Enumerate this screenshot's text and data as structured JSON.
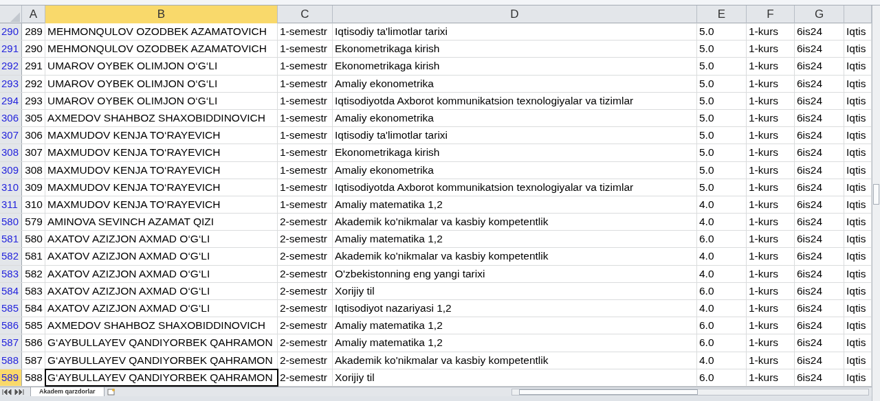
{
  "columns": [
    {
      "label": "A",
      "selected": false
    },
    {
      "label": "B",
      "selected": true
    },
    {
      "label": "C",
      "selected": false
    },
    {
      "label": "D",
      "selected": false
    },
    {
      "label": "E",
      "selected": false
    },
    {
      "label": "F",
      "selected": false
    },
    {
      "label": "G",
      "selected": false
    }
  ],
  "rows": [
    {
      "row": "290",
      "selected": false,
      "cells": [
        "289",
        "MEHMONQULOV OZODBEK AZAMATOVICH",
        "1-semestr",
        "Iqtisodiy ta'limotlar tarixi",
        "5.0",
        "1-kurs",
        "6is24",
        "Iqtis"
      ]
    },
    {
      "row": "291",
      "selected": false,
      "cells": [
        "290",
        "MEHMONQULOV OZODBEK AZAMATOVICH",
        "1-semestr",
        "Ekonometrikaga kirish",
        "5.0",
        "1-kurs",
        "6is24",
        "Iqtis"
      ]
    },
    {
      "row": "292",
      "selected": false,
      "cells": [
        "291",
        "UMAROV OYBEK OLIMJON O‘G‘LI",
        "1-semestr",
        "Ekonometrikaga kirish",
        "5.0",
        "1-kurs",
        "6is24",
        "Iqtis"
      ]
    },
    {
      "row": "293",
      "selected": false,
      "cells": [
        "292",
        "UMAROV OYBEK OLIMJON O‘G‘LI",
        "1-semestr",
        "Amaliy ekonometrika",
        "5.0",
        "1-kurs",
        "6is24",
        "Iqtis"
      ]
    },
    {
      "row": "294",
      "selected": false,
      "cells": [
        "293",
        "UMAROV OYBEK OLIMJON O‘G‘LI",
        "1-semestr",
        "Iqtisodiyotda Axborot kommunikatsion texnologiyalar va tizimlar",
        "5.0",
        "1-kurs",
        "6is24",
        "Iqtis"
      ]
    },
    {
      "row": "306",
      "selected": false,
      "cells": [
        "305",
        "AXMEDOV SHAHBOZ SHAXOBIDDINOVICH",
        "1-semestr",
        "Amaliy ekonometrika",
        "5.0",
        "1-kurs",
        "6is24",
        "Iqtis"
      ]
    },
    {
      "row": "307",
      "selected": false,
      "cells": [
        "306",
        "MAXMUDOV KENJA TO‘RAYEVICH",
        "1-semestr",
        "Iqtisodiy ta'limotlar tarixi",
        "5.0",
        "1-kurs",
        "6is24",
        "Iqtis"
      ]
    },
    {
      "row": "308",
      "selected": false,
      "cells": [
        "307",
        "MAXMUDOV KENJA TO‘RAYEVICH",
        "1-semestr",
        "Ekonometrikaga kirish",
        "5.0",
        "1-kurs",
        "6is24",
        "Iqtis"
      ]
    },
    {
      "row": "309",
      "selected": false,
      "cells": [
        "308",
        "MAXMUDOV KENJA TO‘RAYEVICH",
        "1-semestr",
        "Amaliy ekonometrika",
        "5.0",
        "1-kurs",
        "6is24",
        "Iqtis"
      ]
    },
    {
      "row": "310",
      "selected": false,
      "cells": [
        "309",
        "MAXMUDOV KENJA TO‘RAYEVICH",
        "1-semestr",
        "Iqtisodiyotda Axborot kommunikatsion texnologiyalar va tizimlar",
        "5.0",
        "1-kurs",
        "6is24",
        "Iqtis"
      ]
    },
    {
      "row": "311",
      "selected": false,
      "cells": [
        "310",
        "MAXMUDOV KENJA TO‘RAYEVICH",
        "1-semestr",
        "Amaliy matematika 1,2",
        "4.0",
        "1-kurs",
        "6is24",
        "Iqtis"
      ]
    },
    {
      "row": "580",
      "selected": false,
      "cells": [
        "579",
        "AMINOVA SEVINCH AZAMAT QIZI",
        "2-semestr",
        "Akademik ko'nikmalar va kasbiy kompetentlik",
        "4.0",
        "1-kurs",
        "6is24",
        "Iqtis"
      ]
    },
    {
      "row": "581",
      "selected": false,
      "cells": [
        "580",
        "AXATOV AZIZJON AXMAD O‘G‘LI",
        "2-semestr",
        "Amaliy matematika 1,2",
        "6.0",
        "1-kurs",
        "6is24",
        "Iqtis"
      ]
    },
    {
      "row": "582",
      "selected": false,
      "cells": [
        "581",
        "AXATOV AZIZJON AXMAD O‘G‘LI",
        "2-semestr",
        "Akademik ko'nikmalar va kasbiy kompetentlik",
        "4.0",
        "1-kurs",
        "6is24",
        "Iqtis"
      ]
    },
    {
      "row": "583",
      "selected": false,
      "cells": [
        "582",
        "AXATOV AZIZJON AXMAD O‘G‘LI",
        "2-semestr",
        "O'zbekistonning eng yangi tarixi",
        "4.0",
        "1-kurs",
        "6is24",
        "Iqtis"
      ]
    },
    {
      "row": "584",
      "selected": false,
      "cells": [
        "583",
        "AXATOV AZIZJON AXMAD O‘G‘LI",
        "2-semestr",
        "Xorijiy til",
        "6.0",
        "1-kurs",
        "6is24",
        "Iqtis"
      ]
    },
    {
      "row": "585",
      "selected": false,
      "cells": [
        "584",
        "AXATOV AZIZJON AXMAD O‘G‘LI",
        "2-semestr",
        "Iqtisodiyot nazariyasi 1,2",
        "4.0",
        "1-kurs",
        "6is24",
        "Iqtis"
      ]
    },
    {
      "row": "586",
      "selected": false,
      "cells": [
        "585",
        "AXMEDOV SHAHBOZ SHAXOBIDDINOVICH",
        "2-semestr",
        "Amaliy matematika 1,2",
        "6.0",
        "1-kurs",
        "6is24",
        "Iqtis"
      ]
    },
    {
      "row": "587",
      "selected": false,
      "cells": [
        "586",
        "G‘AYBULLAYEV QANDIYORBEK QAHRAMON",
        "2-semestr",
        "Amaliy matematika 1,2",
        "6.0",
        "1-kurs",
        "6is24",
        "Iqtis"
      ]
    },
    {
      "row": "588",
      "selected": false,
      "cells": [
        "587",
        "G‘AYBULLAYEV QANDIYORBEK QAHRAMON",
        "2-semestr",
        "Akademik ko'nikmalar va kasbiy kompetentlik",
        "4.0",
        "1-kurs",
        "6is24",
        "Iqtis"
      ]
    },
    {
      "row": "589",
      "selected": true,
      "cells": [
        "588",
        "G‘AYBULLAYEV QANDIYORBEK QAHRAMON",
        "2-semestr",
        "Xorijiy til",
        "6.0",
        "1-kurs",
        "6is24",
        "Iqtis"
      ]
    }
  ],
  "sheet_tabs": [
    {
      "label": "Akadem qarzdorlar",
      "selected": true
    }
  ]
}
